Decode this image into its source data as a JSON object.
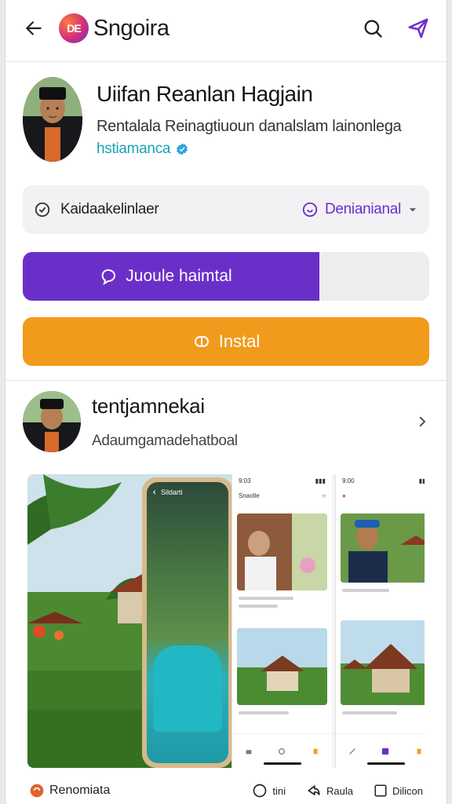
{
  "header": {
    "brand_logo_text": "DE",
    "app_name": "Sngoira"
  },
  "profile": {
    "name": "Uiifan Reanlan Hagjain",
    "subtitle": "Rentalala Reinagtiuoun danalslam lainonlega",
    "handle": "hstiamanca"
  },
  "info_row": {
    "left_label": "Kaidaakelinlaer",
    "right_label": "Denianianal"
  },
  "progress_button": {
    "label": "Juoule haimtal",
    "progress": 0.73
  },
  "install_button": {
    "label": "Instal"
  },
  "developer": {
    "title": "tentjamnekai",
    "subtitle": "Adaumgamadehatboal"
  },
  "gallery": {
    "phone_title": "Sildarti",
    "screen_a_time": "9:03",
    "screen_b_time": "9:00",
    "screen_a_title": "Snaolle"
  },
  "bottom_bar": {
    "left_label": "Renomiata",
    "items": [
      "tini",
      "Raula",
      "Dilicon"
    ]
  },
  "colors": {
    "accent_purple": "#6b2fc9",
    "install_orange": "#f29a1c",
    "handle_teal": "#19a0b8"
  }
}
